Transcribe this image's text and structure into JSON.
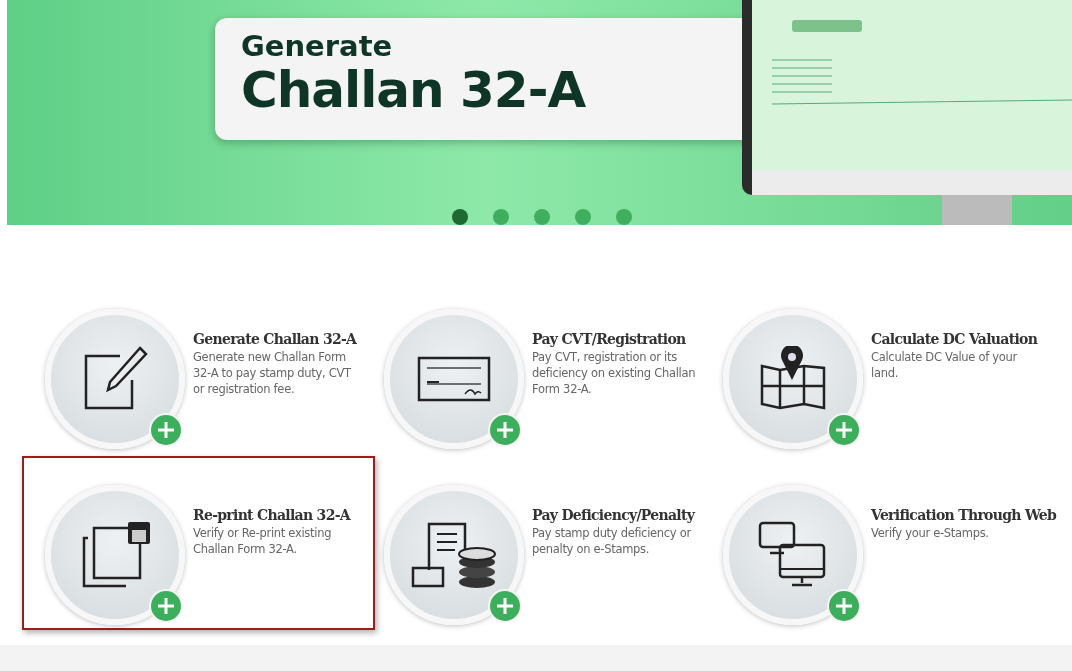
{
  "banner": {
    "title_small": "Generate",
    "title_large": "Challan 32-A",
    "dots": [
      {
        "selected": true
      },
      {
        "selected": false
      },
      {
        "selected": false
      },
      {
        "selected": false
      },
      {
        "selected": false
      }
    ]
  },
  "services": [
    {
      "kind": "edit",
      "title": "Generate Challan 32-A",
      "description": "Generate new Challan Form 32-A to pay stamp duty, CVT or registration fee.",
      "selected": false
    },
    {
      "kind": "cheque",
      "title": "Pay CVT/Registration",
      "description": "Pay CVT, registration or its deficiency on existing Challan Form 32-A.",
      "selected": false
    },
    {
      "kind": "map",
      "title": "Calculate DC Valuation",
      "description": "Calculate DC Value of your land.",
      "selected": false
    },
    {
      "kind": "reprint",
      "title": "Re-print Challan 32-A",
      "description": "Verify or Re-print existing Challan Form 32-A.",
      "selected": true
    },
    {
      "kind": "coins",
      "title": "Pay Deficiency/Penalty",
      "description": "Pay stamp duty deficiency or penalty on e-Stamps.",
      "selected": false
    },
    {
      "kind": "monitors",
      "title": "Verification Through Web",
      "description": "Verify your e-Stamps.",
      "selected": false
    }
  ]
}
